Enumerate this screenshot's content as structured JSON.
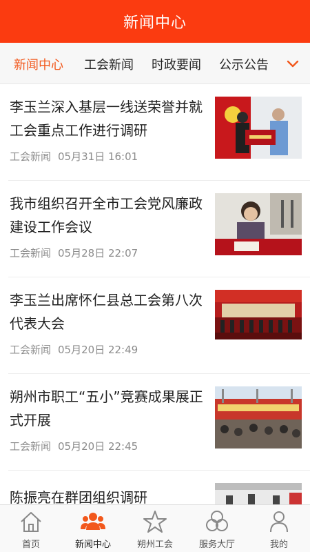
{
  "header": {
    "title": "新闻中心"
  },
  "tabs": [
    {
      "label": "新闻中心",
      "active": true
    },
    {
      "label": "工会新闻",
      "active": false
    },
    {
      "label": "时政要闻",
      "active": false
    },
    {
      "label": "公示公告",
      "active": false
    }
  ],
  "news": [
    {
      "title": "李玉兰深入基层一线送荣誉并就工会重点工作进行调研",
      "category": "工会新闻",
      "date": "05月31日 16:01"
    },
    {
      "title": "我市组织召开全市工会党风廉政建设工作会议",
      "category": "工会新闻",
      "date": "05月28日 22:07"
    },
    {
      "title": "李玉兰出席怀仁县总工会第八次代表大会",
      "category": "工会新闻",
      "date": "05月20日 22:49"
    },
    {
      "title": "朔州市职工“五小”竞赛成果展正式开展",
      "category": "工会新闻",
      "date": "05月20日 22:45"
    },
    {
      "title": "陈振亮在群团组织调研",
      "category": "",
      "date": ""
    }
  ],
  "bottom_nav": [
    {
      "label": "首页",
      "icon": "home-icon",
      "active": false
    },
    {
      "label": "新闻中心",
      "icon": "people-icon",
      "active": true
    },
    {
      "label": "朔州工会",
      "icon": "star-icon",
      "active": false
    },
    {
      "label": "服务大厅",
      "icon": "circles-icon",
      "active": false
    },
    {
      "label": "我的",
      "icon": "user-icon",
      "active": false
    }
  ],
  "colors": {
    "brand": "#fb3b10",
    "active_tab": "#f2581c",
    "meta_text": "#8c8c8c"
  }
}
